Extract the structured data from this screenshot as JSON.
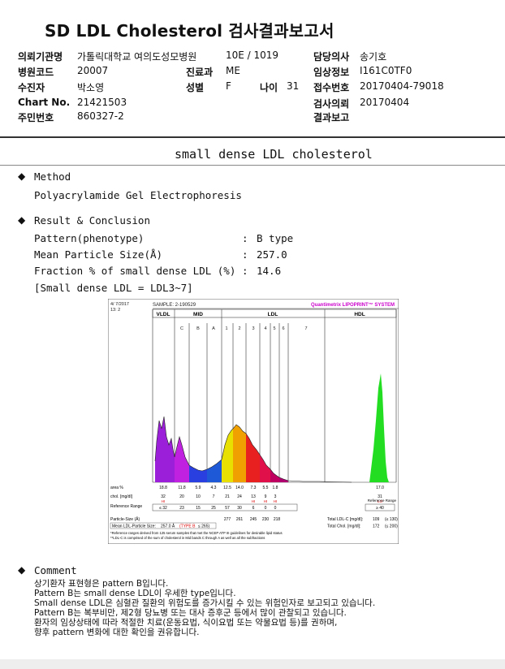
{
  "header": {
    "title": "SD LDL Cholesterol 검사결과보고서",
    "fields": {
      "hospital_label": "의뢰기관명",
      "hospital_value": "가톨릭대학교 여의도성모병원",
      "code_label": "병원코드",
      "code_value": "20007",
      "patient_label": "수진자",
      "patient_value": "박소영",
      "chart_label": "Chart No.",
      "chart_value": "21421503",
      "resident_label": "주민번호",
      "resident_value": "860327-2",
      "ward_value": "10E / 1019",
      "dept_label": "진료과",
      "dept_value": "ME",
      "sex_label": "성별",
      "sex_value": "F",
      "age_label": "나이",
      "age_value": "31",
      "doctor_label": "담당의사",
      "doctor_value": "송기호",
      "clinical_label": "임상정보",
      "clinical_value": "I161C0TF0",
      "receipt_label": "접수번호",
      "receipt_value": "20170404-79018",
      "request_label": "검사의뢰",
      "request_value": "20170404",
      "report_label": "결과보고",
      "report_value": ""
    }
  },
  "report": {
    "title": "small dense LDL cholesterol",
    "method_heading": "Method",
    "method_value": "Polyacrylamide Gel Electrophoresis",
    "result_heading": "Result & Conclusion",
    "rows": [
      {
        "label": "Pattern(phenotype)",
        "sep": ":",
        "value": "B type"
      },
      {
        "label": "Mean Particle Size(Å)",
        "sep": ":",
        "value": "257.0"
      },
      {
        "label": "Fraction % of small dense LDL (%)",
        "sep": ":",
        "value": "14.6"
      }
    ],
    "note": "[Small dense LDL = LDL3~7]"
  },
  "chart": {
    "date": "4/ 7/2017",
    "time": "13: 2",
    "sample": "SAMPLE:   2-190529",
    "brand": "Quantimetrix LIPOPRINT™ SYSTEM",
    "sec_vldl": "VLDL",
    "sec_mid": "MID",
    "sec_ldl": "LDL",
    "sec_hdl": "HDL",
    "mid_bands": [
      "C",
      "B",
      "A"
    ],
    "ldl_bands": [
      "1",
      "2",
      "3",
      "4",
      "5",
      "6",
      "7"
    ],
    "area_label": "area %",
    "area_values": [
      "18.8",
      "11.8",
      "5.9",
      "4.3",
      "12.5",
      "14.0",
      "7.3",
      "5.5",
      "1.8",
      "17.0"
    ],
    "chol_label": "chol. [mg/dl]",
    "chol_values": [
      "32",
      "20",
      "10",
      "7",
      "21",
      "24",
      "13",
      "9",
      "3",
      "31"
    ],
    "chol_flags": [
      "HI",
      "",
      "",
      "",
      "",
      "",
      "HI",
      "HI",
      "HI",
      "LO"
    ],
    "ref_label": "Reference Range",
    "ref_values": [
      "≤ 32",
      "23",
      "15",
      "25",
      "57",
      "30",
      "6",
      "0",
      "0",
      "≥ 40"
    ],
    "particle_label": "Particle-Size (Å)",
    "particle_values": [
      "277",
      "261",
      "245",
      "230",
      "218"
    ],
    "mean_label": "Mean LDL-Particle Size:",
    "mean_value": "257.0 Å",
    "mean_type": "(TYPE B",
    "mean_ref": "≤ 265)",
    "total_ldl_label": "Total LDL-C [mg/dl]:",
    "total_ldl_value": "109",
    "total_ldl_ref": "(≤ 130)",
    "total_chol_label": "Total Chol. [mg/dl]:",
    "total_chol_value": "172",
    "total_chol_ref": "(≤ 200)",
    "ref_range_right": "Reference Range",
    "footnote1": "*Reference ranges derived from 125 serum samples that met the NCEP ATP III guidelines for desirable lipid status",
    "footnote2": "**LDL-C is comprised of the sum of cholesterol in Mid bands C through A as well as all the subfractions"
  },
  "comment": {
    "heading": "Comment",
    "lines": [
      "상기환자 표현형은 pattern B입니다.",
      "Pattern B는 small dense LDL이 우세한 type입니다.",
      "Small dense LDL은 심혈관 질환의 위험도를 증가시킬 수 있는 위험인자로 보고되고 있습니다.",
      "Pattern B는 복부비만, 제2형 당뇨병 또는 대사 증후군 등에서 많이 관찰되고 있습니다.",
      "환자의 임상상태에 따라 적절한 치료(운동요법, 식이요법 또는 약물요법 등)를 권하며,",
      "향후 pattern 변화에 대한 확인을 권유합니다."
    ]
  },
  "colors": {
    "vldl": "#9b1fd8",
    "mid_c": "#c020e0",
    "mid_b": "#2a3fe0",
    "mid_a": "#1e5ad8",
    "ldl1": "#e8e000",
    "ldl2": "#f0a000",
    "ldl3": "#e82020",
    "ldl4": "#e0104a",
    "ldl5": "#c00060",
    "hdl": "#22dd22",
    "brand": "#cc00cc",
    "hi": "#dd0000"
  }
}
